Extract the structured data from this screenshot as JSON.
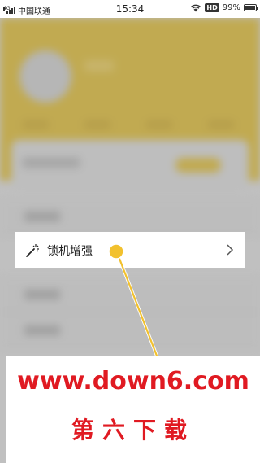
{
  "status_bar": {
    "carrier": "中国联通",
    "network": "4G",
    "time": "15:34",
    "hd_badge": "HD",
    "battery_percent": "99%"
  },
  "highlighted_item": {
    "label": "锁机增强",
    "icon": "magic-wand-icon",
    "chevron": "chevron-right-icon"
  },
  "pointer": {
    "color": "#f2c12e"
  },
  "watermark": {
    "url": "www.down6.com",
    "name": "第六下载",
    "color": "#e01a22"
  }
}
